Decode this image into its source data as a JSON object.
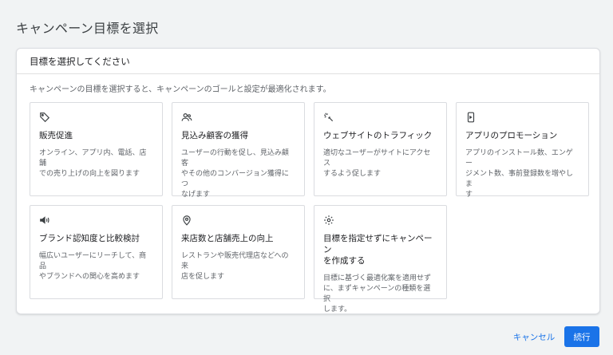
{
  "page": {
    "title": "キャンペーン目標を選択"
  },
  "panel": {
    "header": "目標を選択してください",
    "description": "キャンペーンの目標を選択すると、キャンペーンのゴールと設定が最適化されます。"
  },
  "cards": [
    {
      "icon": "tag-icon",
      "title": "販売促進",
      "desc_lines": [
        "オンライン、アプリ内、電話、店舗",
        "での売り上げの向上を図ります"
      ]
    },
    {
      "icon": "people-icon",
      "title": "見込み顧客の獲得",
      "desc_lines": [
        "ユーザーの行動を促し、見込み顧客",
        "やその他のコンバージョン獲得につ",
        "なげます"
      ]
    },
    {
      "icon": "sparkle-click-icon",
      "title": "ウェブサイトのトラフィック",
      "desc_lines": [
        "適切なユーザーがサイトにアクセス",
        "するよう促します"
      ]
    },
    {
      "icon": "mobile-phone-icon",
      "title": "アプリのプロモーション",
      "desc_lines": [
        "アプリのインストール数、エンゲー",
        "ジメント数、事前登録数を増やしま",
        "す"
      ]
    },
    {
      "icon": "megaphone-icon",
      "title": "ブランド認知度と比較検討",
      "desc_lines": [
        "幅広いユーザーにリーチして、商品",
        "やブランドへの関心を高めます"
      ]
    },
    {
      "icon": "location-pin-icon",
      "title": "来店数と店舗売上の向上",
      "desc_lines": [
        "レストランや販売代理店などへの来",
        "店を促します"
      ]
    },
    {
      "icon": "gear-icon",
      "title_lines": [
        "目標を指定せずにキャンペーン",
        "を作成する"
      ],
      "desc_lines": [
        "目標に基づく最適化案を適用せず",
        "に、まずキャンペーンの種類を選択",
        "します。"
      ]
    }
  ],
  "footer": {
    "cancel_label": "キャンセル",
    "continue_label": "続行"
  },
  "colors": {
    "accent": "#1a73e8",
    "border": "#dadce0",
    "icon": "#3c4043"
  }
}
